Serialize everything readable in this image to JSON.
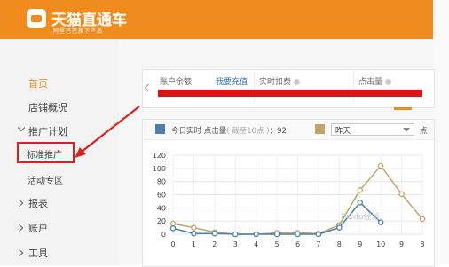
{
  "brand": {
    "title": "天猫直通车",
    "subtitle": "阿里巴巴旗下产品"
  },
  "sidebar": {
    "items": [
      {
        "label": "首页",
        "active": true
      },
      {
        "label": "店铺概况"
      },
      {
        "label": "推广计划",
        "expanded": true
      },
      {
        "label": "标准推广",
        "highlighted": true
      },
      {
        "label": "活动专区"
      },
      {
        "label": "报表"
      },
      {
        "label": "账户"
      },
      {
        "label": "工具"
      }
    ]
  },
  "overview": {
    "balance_label": "账户余额",
    "recharge_link": "我要充值",
    "realtime_deduction_label": "实时扣费",
    "clicks_label": "点击量"
  },
  "chart_panel": {
    "legend_today_label": "今日实时",
    "legend_metric_label": "点击量",
    "legend_range_note": "( 截至10点 )",
    "legend_today_value": "：92",
    "compare_select_value": "昨天",
    "compare_metric_label": "点"
  },
  "chart_data": {
    "type": "line",
    "x": [
      0,
      1,
      2,
      3,
      4,
      5,
      6,
      7,
      8,
      9,
      10,
      11,
      12
    ],
    "x_tick_labels": [
      "0",
      "1",
      "2",
      "3",
      "4",
      "5",
      "6",
      "7",
      "8",
      "9",
      "10",
      "9",
      "8"
    ],
    "ylim": [
      0,
      120
    ],
    "yticks": [
      0,
      20,
      40,
      60,
      80,
      100,
      120
    ],
    "grid": true,
    "series": [
      {
        "color": "#4a7fb0",
        "values": [
          9,
          1,
          1,
          0,
          0,
          0,
          0,
          0,
          10,
          48,
          18,
          null,
          null
        ]
      },
      {
        "color": "#c4a46a",
        "values": [
          16,
          10,
          3,
          0,
          0,
          2,
          2,
          1,
          14,
          67,
          104,
          61,
          23
        ]
      }
    ]
  },
  "watermark": "Baidu经验",
  "colors": {
    "brand_orange": "#f08c1e",
    "annotation_red": "#d9211b",
    "today_series": "#4a7fb0",
    "compare_series": "#c4a46a"
  }
}
